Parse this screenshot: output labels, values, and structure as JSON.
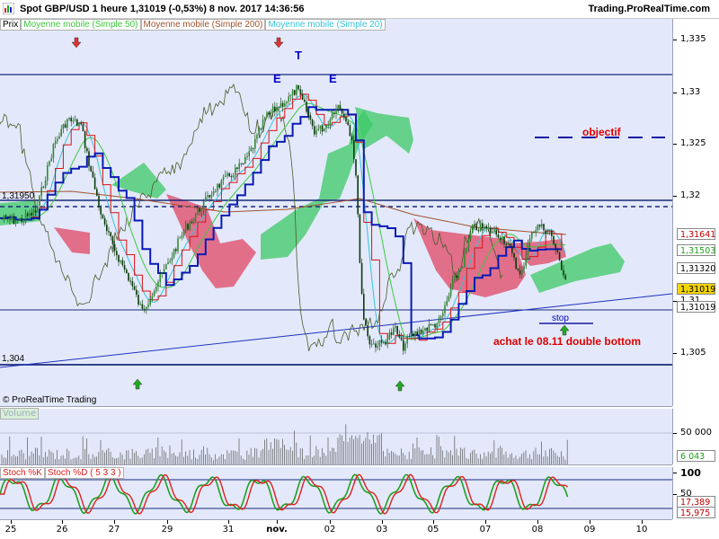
{
  "header": {
    "title": "Spot GBP/USD   1 heure   1,31019 (-0,53%)   8 nov. 2017 14:36:56",
    "site": "Trading.ProRealTime.com"
  },
  "legend": {
    "price": "Prix",
    "ma50": "Moyenne mobile (Simple 50)",
    "ma200": "Moyenne mobile (Simple 200)",
    "ma20": "Moyenne mobile (Simple 20)"
  },
  "colors": {
    "panel_bg": "#e3e9fb",
    "ma50": "#3cc83c",
    "ma200": "#a0522d",
    "ma20": "#35c4d8",
    "ichimoku_up": "#3cc864",
    "ichimoku_down": "#e0506e",
    "candles": "#1a5c1a",
    "kijun": "#0a1ab4",
    "stoch_k": "#20a020",
    "stoch_d": "#e02020",
    "annotation_red": "#dd0000",
    "annotation_blue": "#0000cc",
    "arrow_up": "#22aa22",
    "arrow_down": "#dd3333"
  },
  "main_axis": {
    "ticks": [
      "1,335",
      "1,33",
      "1,325",
      "1,32",
      "1,315",
      "1,31",
      "1,305"
    ],
    "price_boxes": [
      {
        "label": "1,31641",
        "color": "#c00000"
      },
      {
        "label": "1,31503",
        "color": "#20a020"
      },
      {
        "label": "1,31320",
        "color": "#000000"
      },
      {
        "label": "1,31019",
        "color": "#000000",
        "highlight": true
      },
      {
        "label": "1,31019",
        "color": "#000000"
      }
    ]
  },
  "levels": {
    "left_label_1": "1,31950",
    "left_label_2": "1,304"
  },
  "annotations": {
    "objectif": "objectif",
    "stop": "stop",
    "buy_note": "achat le 08.11 double bottom",
    "wave_e1": "E",
    "wave_t": "T",
    "wave_e2": "E"
  },
  "copyright": "© ProRealTime Trading",
  "volume": {
    "label": "Volume",
    "ticks": [
      "50 000"
    ],
    "current": "6 043"
  },
  "stochastic": {
    "k_label": "Stoch %K",
    "d_label": "Stoch %D ( 5 3 3 )",
    "ticks": [
      "100",
      "50"
    ],
    "k_value": "17,389",
    "d_value": "15,975"
  },
  "x_axis": {
    "labels": [
      "25",
      "26",
      "27",
      "29",
      "31",
      "nov.",
      "02",
      "03",
      "05",
      "07",
      "08",
      "09",
      "10"
    ]
  }
}
